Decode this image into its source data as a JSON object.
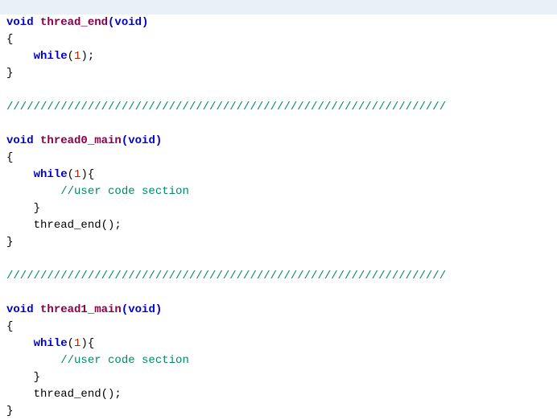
{
  "code": {
    "kw_void": "void",
    "kw_while": "while",
    "fn_thread_end": "thread_end",
    "fn_thread0_main": "thread0_main",
    "fn_thread1_main": "thread1_main",
    "paren_void": "(void)",
    "open_brace": "{",
    "close_brace": "}",
    "while_1": "(1);",
    "while_1_open": "(1){",
    "close_brace_indent": "    }",
    "comment_user": "//user code section",
    "call_thread_end": "thread_end();",
    "separator": "/////////////////////////////////////////////////////////////////"
  }
}
